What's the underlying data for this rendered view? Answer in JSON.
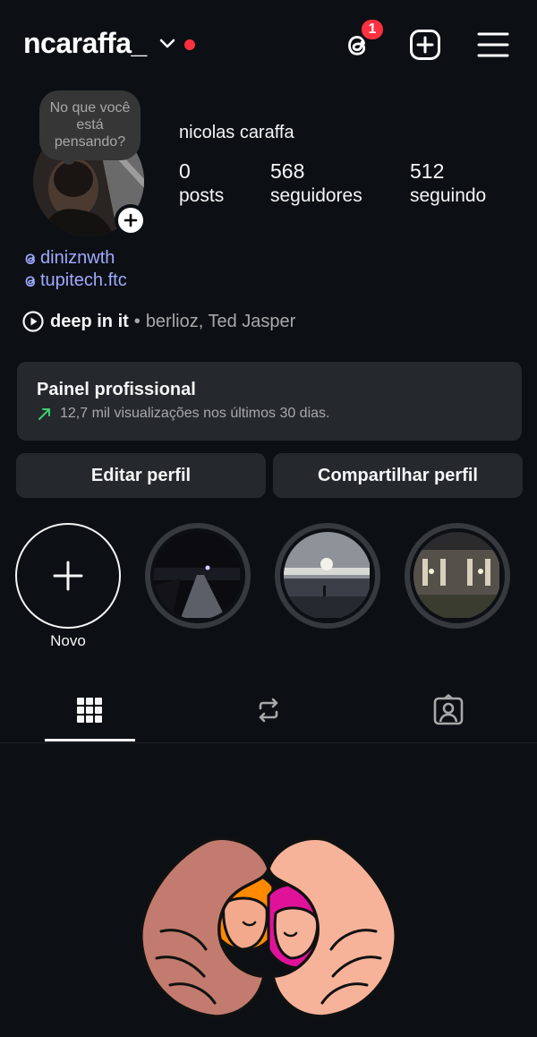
{
  "header": {
    "username": "ncaraffa_",
    "threads_notification_count": "1"
  },
  "profile": {
    "note_text": "No que você está pensando?",
    "display_name": "nicolas caraffa",
    "stats": [
      {
        "value": "0",
        "label": "posts"
      },
      {
        "value": "568",
        "label": "seguidores"
      },
      {
        "value": "512",
        "label": "seguindo"
      }
    ],
    "threads_links": [
      "diniznwth",
      "tupitech.ftc"
    ],
    "music": {
      "song": "deep in it",
      "separator": "•",
      "artists": "berlioz, Ted Jasper"
    }
  },
  "professional_panel": {
    "title": "Painel profissional",
    "subtitle": "12,7 mil visualizações nos últimos 30 dias."
  },
  "actions": {
    "edit_profile": "Editar perfil",
    "share_profile": "Compartilhar perfil"
  },
  "highlights": {
    "new_label": "Novo",
    "items": [
      "night-road-highlight",
      "sunset-sea-highlight",
      "building-lights-highlight"
    ]
  },
  "tabs": [
    "grid-icon",
    "reposts-icon",
    "tagged-icon"
  ],
  "colors": {
    "background": "#0c1014",
    "surface": "#25292e",
    "link": "#a1a9ff",
    "badge": "#ff3040",
    "trend": "#3ecf6e"
  }
}
